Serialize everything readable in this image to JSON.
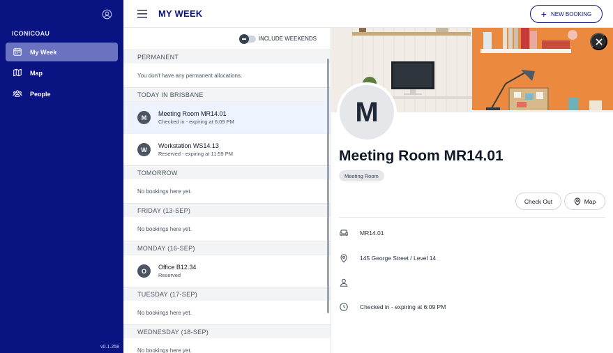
{
  "sidebar": {
    "org_name": "ICONICOAU",
    "items": [
      {
        "label": "My Week",
        "icon": "calendar-icon",
        "active": true
      },
      {
        "label": "Map",
        "icon": "map-icon",
        "active": false
      },
      {
        "label": "People",
        "icon": "people-icon",
        "active": false
      }
    ],
    "version": "v0.1.258"
  },
  "header": {
    "title": "MY WEEK",
    "new_booking_label": "NEW BOOKING"
  },
  "list": {
    "weekends_label": "INCLUDE WEEKENDS",
    "sections": [
      {
        "title": "PERMANENT",
        "empty_text": "You don't have any permanent allocations."
      },
      {
        "title": "TODAY IN BRISBANE",
        "bookings": [
          {
            "initial": "M",
            "name": "Meeting Room MR14.01",
            "status": "Checked in - expiring at 6:09 PM"
          },
          {
            "initial": "W",
            "name": "Workstation WS14.13",
            "status": "Reserved - expiring at 11:59 PM"
          }
        ]
      },
      {
        "title": "TOMORROW",
        "empty_text": "No bookings here yet."
      },
      {
        "title": "FRIDAY (13-SEP)",
        "empty_text": "No bookings here yet."
      },
      {
        "title": "MONDAY (16-SEP)",
        "bookings": [
          {
            "initial": "O",
            "name": "Office B12.34",
            "status": "Reserved"
          }
        ]
      },
      {
        "title": "TUESDAY (17-SEP)",
        "empty_text": "No bookings here yet."
      },
      {
        "title": "WEDNESDAY (18-SEP)",
        "empty_text": "No bookings here yet."
      }
    ]
  },
  "detail": {
    "avatar_initial": "M",
    "title": "Meeting Room MR14.01",
    "type_tag": "Meeting Room",
    "check_out_label": "Check Out",
    "map_label": "Map",
    "space_id": "MR14.01",
    "location": "145 George Street / Level 14",
    "assignee": "",
    "status": "Checked in - expiring at 6:09 PM"
  },
  "colors": {
    "sidebar_bg": "#0a1382",
    "sidebar_active": "#6b72c0",
    "accent": "#0a1382"
  }
}
